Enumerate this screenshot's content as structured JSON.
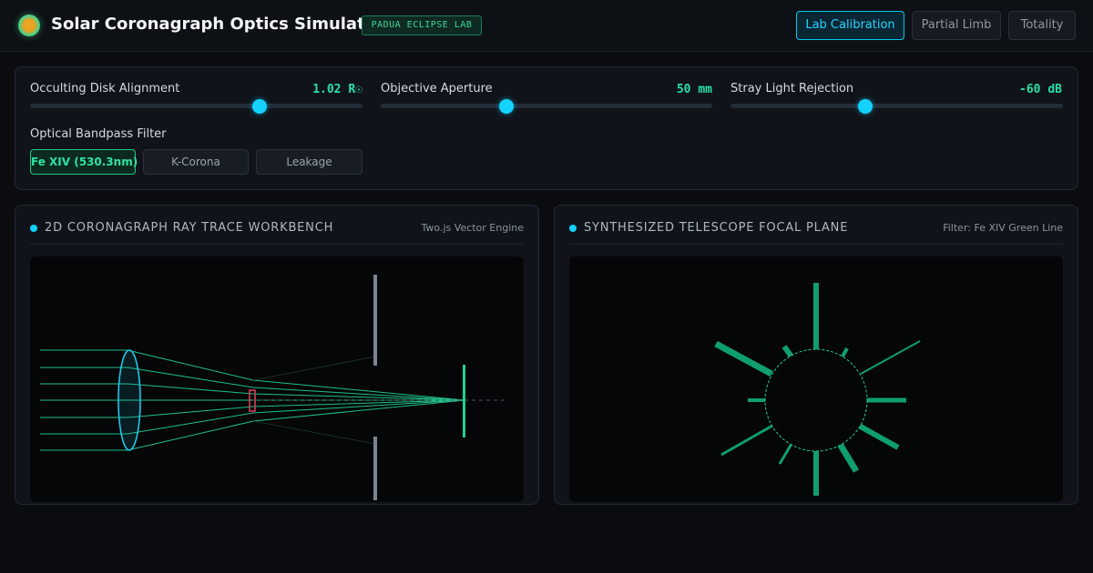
{
  "header": {
    "title": "Solar Coronagraph Optics Simulator",
    "badge": "PADUA ECLIPSE LAB",
    "modes": [
      {
        "label": "Lab Calibration",
        "active": true
      },
      {
        "label": "Partial Limb",
        "active": false
      },
      {
        "label": "Totality",
        "active": false
      }
    ]
  },
  "controls": {
    "occulting_disk": {
      "label": "Occulting Disk Alignment",
      "value": "1.02 R☉",
      "level": 0.69
    },
    "aperture": {
      "label": "Objective Aperture",
      "value": "50 mm",
      "level": 0.38
    },
    "stray_light": {
      "label": "Stray Light Rejection",
      "value": "-60 dB",
      "level": 0.41
    },
    "filter": {
      "label": "Optical Bandpass Filter",
      "options": [
        {
          "label": "Fe XIV (530.3nm)",
          "active": true
        },
        {
          "label": "K-Corona",
          "active": false
        },
        {
          "label": "Leakage",
          "active": false
        }
      ]
    }
  },
  "raytrace": {
    "title": "2D CORONAGRAPH RAY TRACE WORKBENCH",
    "engine": "Two.js Vector Engine"
  },
  "focal_plane": {
    "title": "SYNTHESIZED TELESCOPE FOCAL PLANE",
    "filter_label": "Filter: Fe XIV Green Line"
  },
  "colors": {
    "accent": "#13d2ff",
    "value_green": "#2be0a6",
    "ray_green": "#1fbf8a",
    "lens_cyan": "#22c8e8",
    "occulter_red": "#e0405a"
  }
}
